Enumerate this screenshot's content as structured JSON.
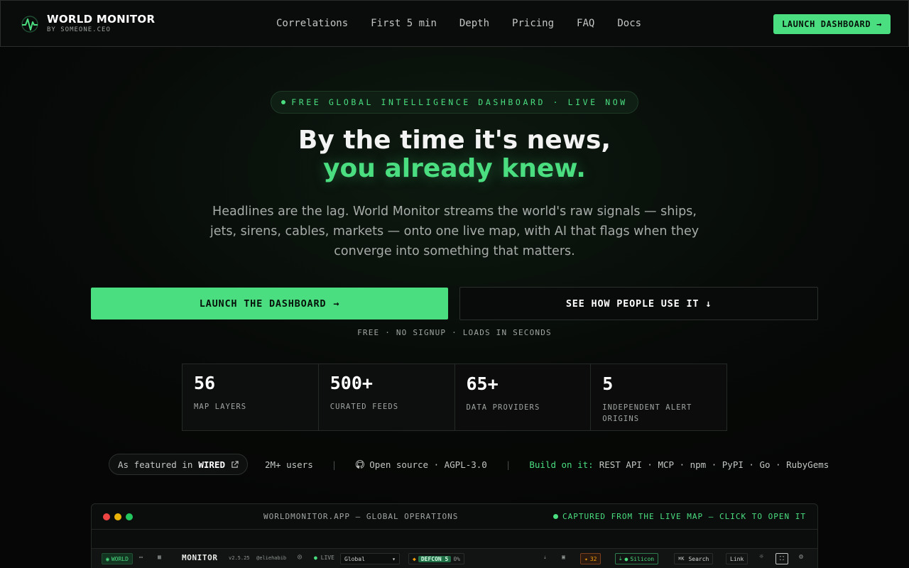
{
  "nav": {
    "brand_title": "WORLD MONITOR",
    "brand_sub": "BY SOMEONE.CEO",
    "links": [
      "Correlations",
      "First 5 min",
      "Depth",
      "Pricing",
      "FAQ",
      "Docs"
    ],
    "cta": "LAUNCH DASHBOARD"
  },
  "hero": {
    "pill": "FREE GLOBAL INTELLIGENCE DASHBOARD · LIVE NOW",
    "title_line1": "By the time it's news,",
    "title_line2": "you already knew.",
    "lead": "Headlines are the lag. World Monitor streams the world's raw signals — ships, jets, sirens, cables, markets — onto one live map, with AI that flags when they converge into something that matters.",
    "primary_button": "LAUNCH THE DASHBOARD",
    "secondary_button": "SEE HOW PEOPLE USE IT ↓",
    "subnote": "FREE · NO SIGNUP · LOADS IN SECONDS"
  },
  "stats": [
    {
      "value": "56",
      "label": "MAP LAYERS"
    },
    {
      "value": "500+",
      "label": "CURATED FEEDS"
    },
    {
      "value": "65+",
      "label": "DATA PROVIDERS"
    },
    {
      "value": "5",
      "label": "INDEPENDENT ALERT ORIGINS"
    }
  ],
  "strip": {
    "featured_prefix": "As featured in",
    "featured_name": "WIRED",
    "users": "2M+ users",
    "open_source": "Open source · AGPL-3.0",
    "build_label": "Build on it:",
    "build_items": "REST API · MCP · npm · PyPI · Go · RubyGems"
  },
  "preview": {
    "title": "WORLDMONITOR.APP — GLOBAL OPERATIONS",
    "right_label": "CAPTURED FROM THE LIVE MAP — CLICK TO OPEN IT",
    "app": {
      "world_tab": "WORLD",
      "name": "MONITOR",
      "version": "v2.5.25",
      "handle": "@eliehabib",
      "live": "LIVE",
      "region": "Global",
      "defcon": "DEFCON 5",
      "defcon_pct": "0%",
      "alerts": "32",
      "silicon": "Silicon",
      "search_key": "⌘K",
      "search": "Search",
      "link": "Link"
    }
  },
  "colors": {
    "accent": "#4ade80",
    "background": "#070a08"
  }
}
